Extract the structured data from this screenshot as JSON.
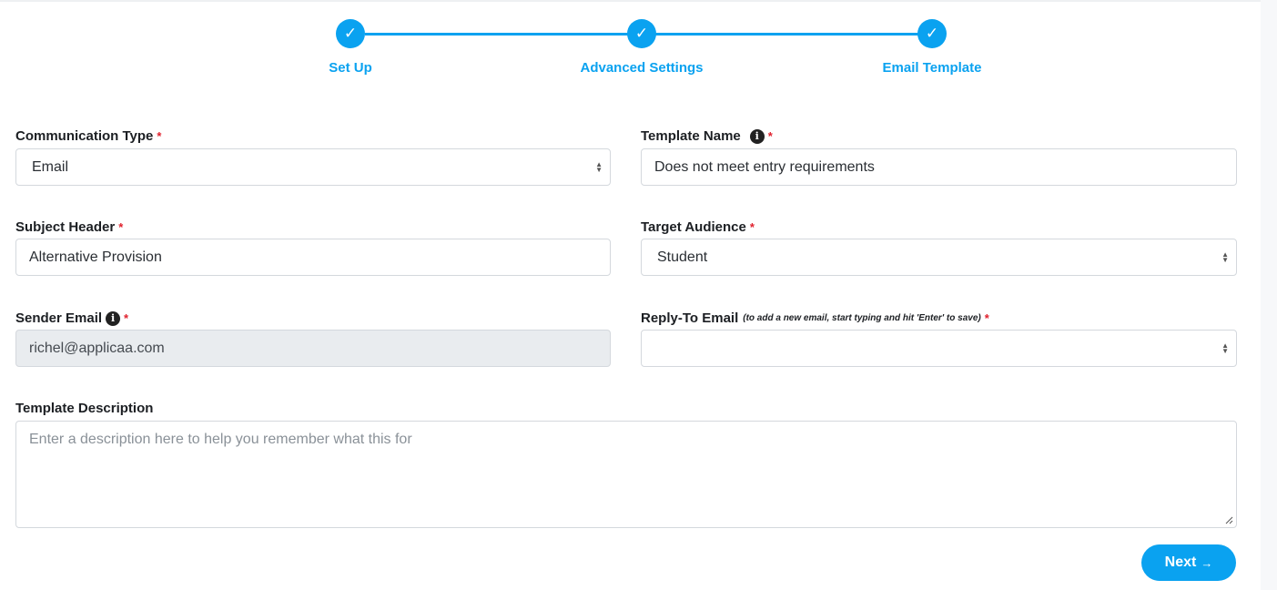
{
  "stepper": {
    "steps": [
      {
        "label": "Set Up",
        "check": "✓"
      },
      {
        "label": "Advanced Settings",
        "check": "✓"
      },
      {
        "label": "Email Template",
        "check": "✓"
      }
    ],
    "color": "#0aa2f0"
  },
  "form": {
    "communication_type": {
      "label": "Communication Type",
      "required": "*",
      "value": "Email"
    },
    "template_name": {
      "label": "Template Name",
      "required": "*",
      "value": "Does not meet entry requirements",
      "info_icon": "info-icon"
    },
    "subject_header": {
      "label": "Subject Header",
      "required": "*",
      "value": "Alternative Provision"
    },
    "target_audience": {
      "label": "Target Audience",
      "required": "*",
      "value": "Student"
    },
    "sender_email": {
      "label": "Sender Email",
      "required": "*",
      "value": "richel@applicaa.com",
      "info_icon": "info-icon"
    },
    "reply_to_email": {
      "label": "Reply-To Email",
      "hint": "(to add a new email, start typing and hit 'Enter' to save)",
      "required": "*",
      "value": ""
    },
    "template_description": {
      "label": "Template Description",
      "placeholder": "Enter a description here to help you remember what this for"
    }
  },
  "actions": {
    "next_label": "Next",
    "next_icon": "→"
  }
}
